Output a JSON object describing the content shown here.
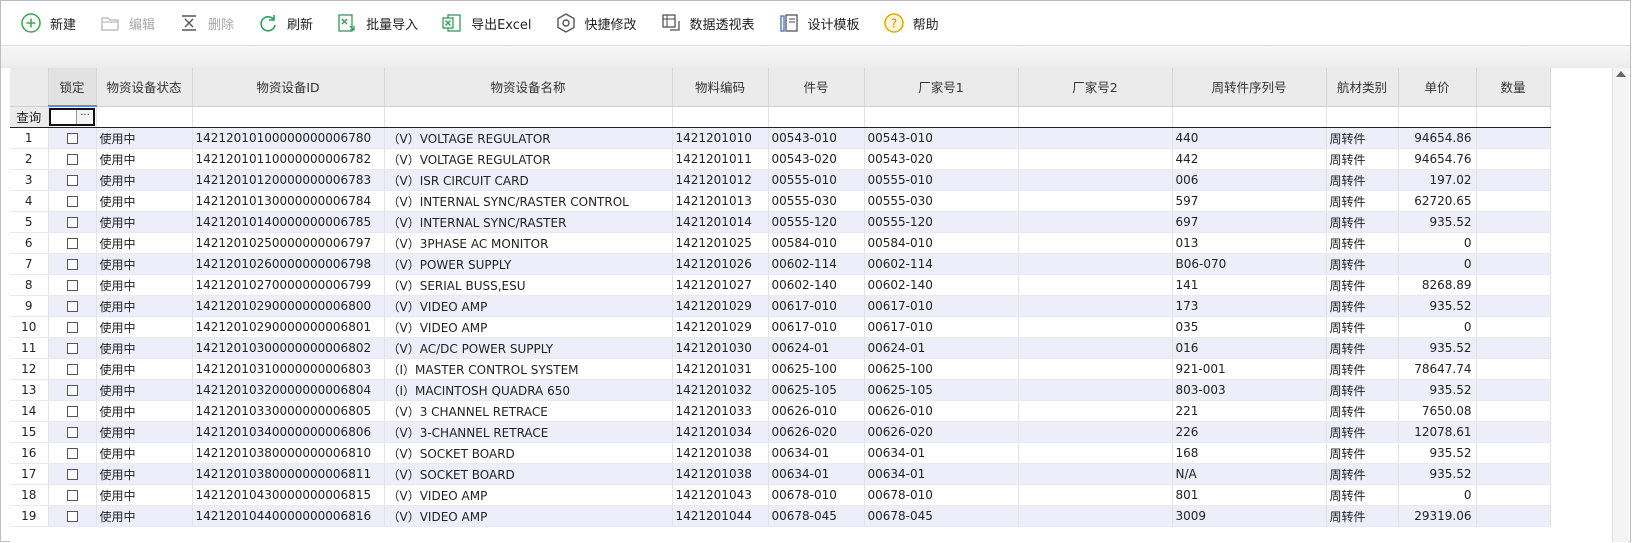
{
  "toolbar": {
    "buttons": [
      {
        "label": "新建",
        "icon": "plus-circle-icon",
        "enabled": true
      },
      {
        "label": "编辑",
        "icon": "folder-icon",
        "enabled": false
      },
      {
        "label": "删除",
        "icon": "delete-icon",
        "enabled": false
      },
      {
        "label": "刷新",
        "icon": "refresh-icon",
        "enabled": true
      },
      {
        "label": "批量导入",
        "icon": "import-icon",
        "enabled": true
      },
      {
        "label": "导出Excel",
        "icon": "excel-icon",
        "enabled": true
      },
      {
        "label": "快捷修改",
        "icon": "hexagon-icon",
        "enabled": true
      },
      {
        "label": "数据透视表",
        "icon": "pivot-icon",
        "enabled": true
      },
      {
        "label": "设计模板",
        "icon": "template-icon",
        "enabled": true
      },
      {
        "label": "帮助",
        "icon": "help-icon",
        "enabled": true
      }
    ]
  },
  "grid": {
    "filter_label": "查询",
    "columns": [
      "锁定",
      "物资设备状态",
      "物资设备ID",
      "物资设备名称",
      "物料编码",
      "件号",
      "厂家号1",
      "厂家号2",
      "周转件序列号",
      "航材类别",
      "单价",
      "数量"
    ],
    "rows": [
      {
        "n": "1",
        "status": "使用中",
        "id": "14212010100000000006780",
        "name": "（V）VOLTAGE REGULATOR",
        "code": "1421201010",
        "part": "00543-010",
        "m1": "00543-010",
        "m2": "",
        "serial": "440",
        "cat": "周转件",
        "price": "94654.86",
        "qty": ""
      },
      {
        "n": "2",
        "status": "使用中",
        "id": "14212010110000000006782",
        "name": "（V）VOLTAGE REGULATOR",
        "code": "1421201011",
        "part": "00543-020",
        "m1": "00543-020",
        "m2": "",
        "serial": "442",
        "cat": "周转件",
        "price": "94654.76",
        "qty": ""
      },
      {
        "n": "3",
        "status": "使用中",
        "id": "14212010120000000006783",
        "name": "（V）ISR CIRCUIT CARD",
        "code": "1421201012",
        "part": "00555-010",
        "m1": "00555-010",
        "m2": "",
        "serial": "006",
        "cat": "周转件",
        "price": "197.02",
        "qty": ""
      },
      {
        "n": "4",
        "status": "使用中",
        "id": "14212010130000000006784",
        "name": "（V）INTERNAL SYNC/RASTER CONTROL",
        "code": "1421201013",
        "part": "00555-030",
        "m1": "00555-030",
        "m2": "",
        "serial": "597",
        "cat": "周转件",
        "price": "62720.65",
        "qty": ""
      },
      {
        "n": "5",
        "status": "使用中",
        "id": "14212010140000000006785",
        "name": "（V）INTERNAL SYNC/RASTER",
        "code": "1421201014",
        "part": "00555-120",
        "m1": "00555-120",
        "m2": "",
        "serial": "697",
        "cat": "周转件",
        "price": "935.52",
        "qty": ""
      },
      {
        "n": "6",
        "status": "使用中",
        "id": "14212010250000000006797",
        "name": "（V）3PHASE AC MONITOR",
        "code": "1421201025",
        "part": "00584-010",
        "m1": "00584-010",
        "m2": "",
        "serial": "013",
        "cat": "周转件",
        "price": "0",
        "qty": ""
      },
      {
        "n": "7",
        "status": "使用中",
        "id": "14212010260000000006798",
        "name": "（V）POWER SUPPLY",
        "code": "1421201026",
        "part": "00602-114",
        "m1": "00602-114",
        "m2": "",
        "serial": "B06-070",
        "cat": "周转件",
        "price": "0",
        "qty": ""
      },
      {
        "n": "8",
        "status": "使用中",
        "id": "14212010270000000006799",
        "name": "（V）SERIAL BUSS,ESU",
        "code": "1421201027",
        "part": "00602-140",
        "m1": "00602-140",
        "m2": "",
        "serial": "141",
        "cat": "周转件",
        "price": "8268.89",
        "qty": ""
      },
      {
        "n": "9",
        "status": "使用中",
        "id": "14212010290000000006800",
        "name": "（V）VIDEO AMP",
        "code": "1421201029",
        "part": "00617-010",
        "m1": "00617-010",
        "m2": "",
        "serial": "173",
        "cat": "周转件",
        "price": "935.52",
        "qty": ""
      },
      {
        "n": "10",
        "status": "使用中",
        "id": "14212010290000000006801",
        "name": "（V）VIDEO AMP",
        "code": "1421201029",
        "part": "00617-010",
        "m1": "00617-010",
        "m2": "",
        "serial": "035",
        "cat": "周转件",
        "price": "0",
        "qty": ""
      },
      {
        "n": "11",
        "status": "使用中",
        "id": "14212010300000000006802",
        "name": "（V）AC/DC POWER SUPPLY",
        "code": "1421201030",
        "part": "00624-01",
        "m1": "00624-01",
        "m2": "",
        "serial": "016",
        "cat": "周转件",
        "price": "935.52",
        "qty": ""
      },
      {
        "n": "12",
        "status": "使用中",
        "id": "14212010310000000006803",
        "name": "（I）MASTER CONTROL SYSTEM",
        "code": "1421201031",
        "part": "00625-100",
        "m1": "00625-100",
        "m2": "",
        "serial": "921-001",
        "cat": "周转件",
        "price": "78647.74",
        "qty": ""
      },
      {
        "n": "13",
        "status": "使用中",
        "id": "14212010320000000006804",
        "name": "（I）MACINTOSH QUADRA 650",
        "code": "1421201032",
        "part": "00625-105",
        "m1": "00625-105",
        "m2": "",
        "serial": "803-003",
        "cat": "周转件",
        "price": "935.52",
        "qty": ""
      },
      {
        "n": "14",
        "status": "使用中",
        "id": "14212010330000000006805",
        "name": "（V）3 CHANNEL RETRACE",
        "code": "1421201033",
        "part": "00626-010",
        "m1": "00626-010",
        "m2": "",
        "serial": "221",
        "cat": "周转件",
        "price": "7650.08",
        "qty": ""
      },
      {
        "n": "15",
        "status": "使用中",
        "id": "14212010340000000006806",
        "name": "（V）3-CHANNEL RETRACE",
        "code": "1421201034",
        "part": "00626-020",
        "m1": "00626-020",
        "m2": "",
        "serial": "226",
        "cat": "周转件",
        "price": "12078.61",
        "qty": ""
      },
      {
        "n": "16",
        "status": "使用中",
        "id": "14212010380000000006810",
        "name": "（V）SOCKET BOARD",
        "code": "1421201038",
        "part": "00634-01",
        "m1": "00634-01",
        "m2": "",
        "serial": "168",
        "cat": "周转件",
        "price": "935.52",
        "qty": ""
      },
      {
        "n": "17",
        "status": "使用中",
        "id": "14212010380000000006811",
        "name": "（V）SOCKET BOARD",
        "code": "1421201038",
        "part": "00634-01",
        "m1": "00634-01",
        "m2": "",
        "serial": "N/A",
        "cat": "周转件",
        "price": "935.52",
        "qty": ""
      },
      {
        "n": "18",
        "status": "使用中",
        "id": "14212010430000000006815",
        "name": "（V）VIDEO AMP",
        "code": "1421201043",
        "part": "00678-010",
        "m1": "00678-010",
        "m2": "",
        "serial": "801",
        "cat": "周转件",
        "price": "0",
        "qty": ""
      },
      {
        "n": "19",
        "status": "使用中",
        "id": "14212010440000000006816",
        "name": "（V）VIDEO AMP",
        "code": "1421201044",
        "part": "00678-045",
        "m1": "00678-045",
        "m2": "",
        "serial": "3009",
        "cat": "周转件",
        "price": "29319.06",
        "qty": ""
      }
    ]
  }
}
